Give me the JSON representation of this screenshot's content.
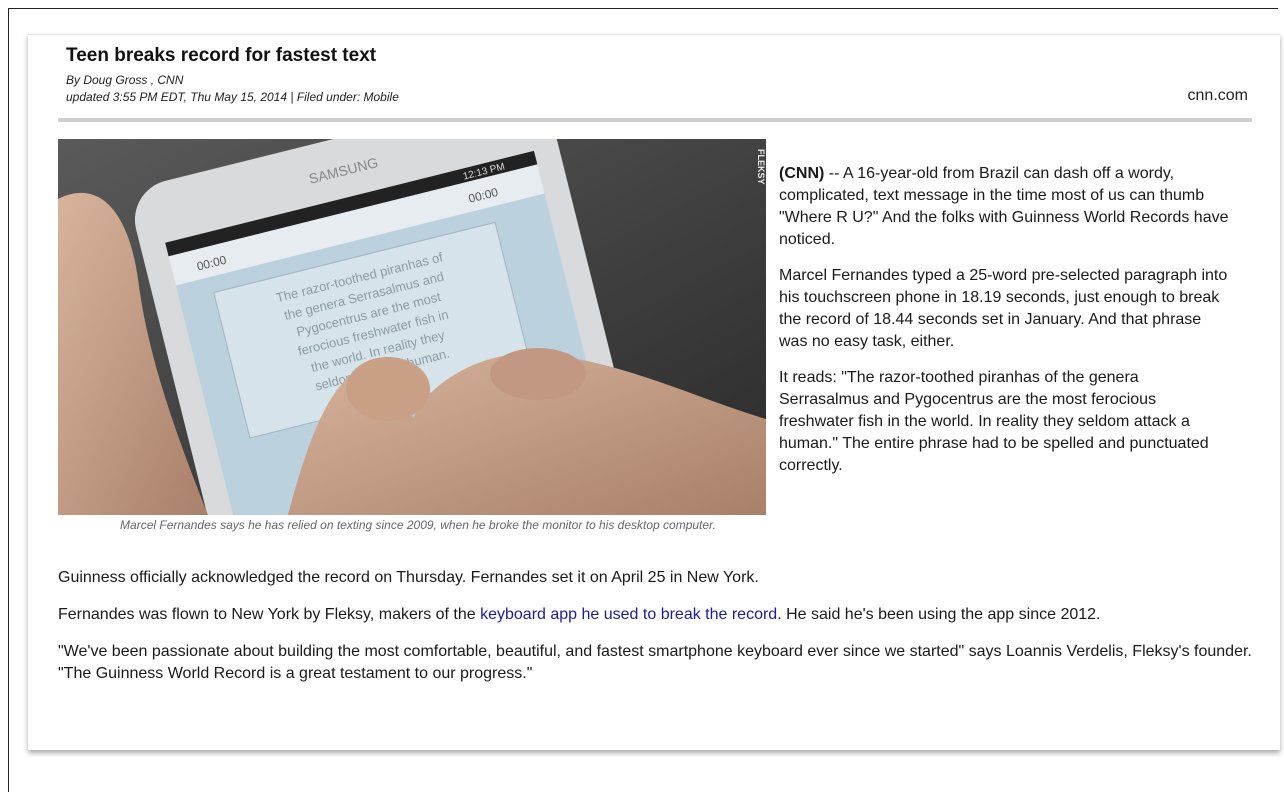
{
  "article": {
    "title": "Teen breaks record for fastest text",
    "byline": "By Doug Gross , CNN",
    "updated": "updated 3:55 PM EDT, Thu May 15, 2014 | Filed under: Mobile",
    "source": "cnn.com"
  },
  "photo": {
    "credit": "FLEKSY",
    "brand": "SAMSUNG",
    "phone_status_time": "12:13 PM",
    "timer_left": "00:00",
    "timer_right": "00:00",
    "screen_text": [
      "The razor-toothed piranhas of",
      "the genera Serrasalmus and",
      "Pygocentrus are the most",
      "ferocious freshwater fish in",
      "the world. In reality they",
      "seldom attack a human."
    ],
    "caption": "Marcel Fernandes says he has relied on texting since 2009, when he broke the monitor to his desktop computer."
  },
  "body": {
    "p1_lead": "(CNN)",
    "p1_rest": " -- A 16-year-old from Brazil can dash off a wordy, complicated, text message in the time most of us can thumb \"Where R U?\" And the folks with Guinness World Records have noticed.",
    "p2": "Marcel Fernandes typed a 25-word pre-selected paragraph into his touchscreen phone in 18.19 seconds, just enough to break the record of 18.44 seconds set in January. And that phrase was no easy task, either.",
    "p3": "It reads: \"The razor-toothed piranhas of the genera Serrasalmus and Pygocentrus are the most ferocious freshwater fish in the world. In reality they seldom attack a human.\" The entire phrase had to be spelled and punctuated correctly.",
    "p4": "Guinness officially acknowledged the record on Thursday. Fernandes set it on April 25 in New York.",
    "p5_before": "Fernandes was flown to New York by Fleksy, makers of the ",
    "p5_link": "keyboard app he used to break the record",
    "p5_after": ". He said he's been using the app since 2012.",
    "p6": "\"We've been passionate about building the most comfortable, beautiful, and fastest smartphone keyboard ever since we started\" says Loannis Verdelis, Fleksy's founder. \"The Guinness World Record is a great testament to our progress.\""
  },
  "colors": {
    "link": "#1a1aa6",
    "rule": "#cfcfcf"
  }
}
